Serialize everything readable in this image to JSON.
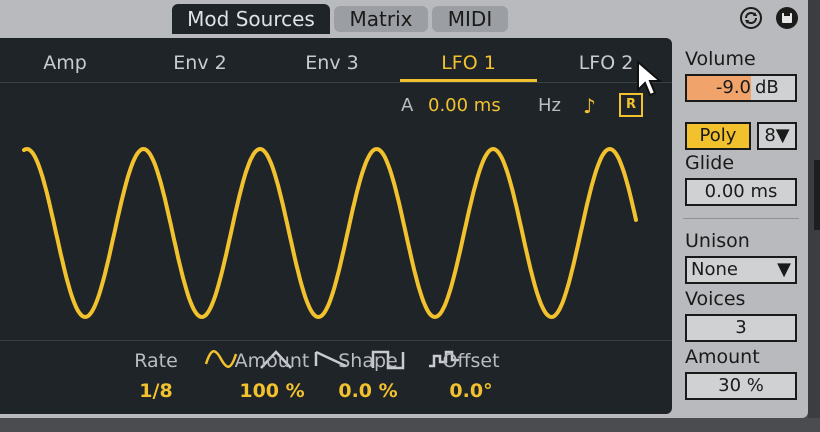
{
  "top_tabs": [
    {
      "label": "Mod Sources",
      "active": true
    },
    {
      "label": "Matrix",
      "active": false
    },
    {
      "label": "MIDI",
      "active": false
    }
  ],
  "top_icons": {
    "cycle": "cycle-icon",
    "save": "save-icon"
  },
  "sub_tabs": [
    {
      "label": "Amp"
    },
    {
      "label": "Env 2"
    },
    {
      "label": "Env 3"
    },
    {
      "label": "LFO 1",
      "active": true
    },
    {
      "label": "LFO 2"
    }
  ],
  "lfo": {
    "attack_label": "A",
    "attack_value": "0.00 ms",
    "hz_label": "Hz",
    "sync_icon": "note-icon",
    "retrigger_label": "R",
    "shapes": [
      "sine",
      "triangle",
      "saw",
      "square",
      "random"
    ],
    "selected_shape": "sine",
    "params": [
      {
        "label": "Rate",
        "value": "1/8"
      },
      {
        "label": "Amount",
        "value": "100 %"
      },
      {
        "label": "Shape",
        "value": "0.0 %"
      },
      {
        "label": "Offset",
        "value": "0.0°"
      }
    ]
  },
  "side": {
    "volume_label": "Volume",
    "volume_value": "-9.0",
    "volume_unit": "dB",
    "poly_label": "Poly",
    "voices_select": "8",
    "glide_label": "Glide",
    "glide_value": "0.00 ms",
    "unison_label": "Unison",
    "unison_value": "None",
    "voices_label": "Voices",
    "voices_value": "3",
    "amount_label": "Amount",
    "amount_value": "30 %"
  },
  "colors": {
    "accent": "#f2c12e",
    "panel": "#1f2429",
    "frame": "#b8babd",
    "volume_fill": "#f0a36a"
  }
}
